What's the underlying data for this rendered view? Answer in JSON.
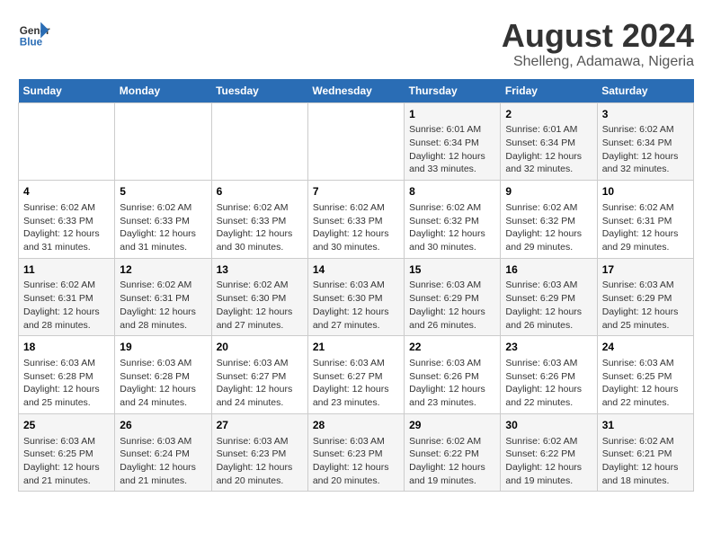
{
  "logo": {
    "line1": "General",
    "line2": "Blue"
  },
  "title": "August 2024",
  "subtitle": "Shelleng, Adamawa, Nigeria",
  "weekdays": [
    "Sunday",
    "Monday",
    "Tuesday",
    "Wednesday",
    "Thursday",
    "Friday",
    "Saturday"
  ],
  "weeks": [
    [
      {
        "day": "",
        "info": ""
      },
      {
        "day": "",
        "info": ""
      },
      {
        "day": "",
        "info": ""
      },
      {
        "day": "",
        "info": ""
      },
      {
        "day": "1",
        "info": "Sunrise: 6:01 AM\nSunset: 6:34 PM\nDaylight: 12 hours\nand 33 minutes."
      },
      {
        "day": "2",
        "info": "Sunrise: 6:01 AM\nSunset: 6:34 PM\nDaylight: 12 hours\nand 32 minutes."
      },
      {
        "day": "3",
        "info": "Sunrise: 6:02 AM\nSunset: 6:34 PM\nDaylight: 12 hours\nand 32 minutes."
      }
    ],
    [
      {
        "day": "4",
        "info": "Sunrise: 6:02 AM\nSunset: 6:33 PM\nDaylight: 12 hours\nand 31 minutes."
      },
      {
        "day": "5",
        "info": "Sunrise: 6:02 AM\nSunset: 6:33 PM\nDaylight: 12 hours\nand 31 minutes."
      },
      {
        "day": "6",
        "info": "Sunrise: 6:02 AM\nSunset: 6:33 PM\nDaylight: 12 hours\nand 30 minutes."
      },
      {
        "day": "7",
        "info": "Sunrise: 6:02 AM\nSunset: 6:33 PM\nDaylight: 12 hours\nand 30 minutes."
      },
      {
        "day": "8",
        "info": "Sunrise: 6:02 AM\nSunset: 6:32 PM\nDaylight: 12 hours\nand 30 minutes."
      },
      {
        "day": "9",
        "info": "Sunrise: 6:02 AM\nSunset: 6:32 PM\nDaylight: 12 hours\nand 29 minutes."
      },
      {
        "day": "10",
        "info": "Sunrise: 6:02 AM\nSunset: 6:31 PM\nDaylight: 12 hours\nand 29 minutes."
      }
    ],
    [
      {
        "day": "11",
        "info": "Sunrise: 6:02 AM\nSunset: 6:31 PM\nDaylight: 12 hours\nand 28 minutes."
      },
      {
        "day": "12",
        "info": "Sunrise: 6:02 AM\nSunset: 6:31 PM\nDaylight: 12 hours\nand 28 minutes."
      },
      {
        "day": "13",
        "info": "Sunrise: 6:02 AM\nSunset: 6:30 PM\nDaylight: 12 hours\nand 27 minutes."
      },
      {
        "day": "14",
        "info": "Sunrise: 6:03 AM\nSunset: 6:30 PM\nDaylight: 12 hours\nand 27 minutes."
      },
      {
        "day": "15",
        "info": "Sunrise: 6:03 AM\nSunset: 6:29 PM\nDaylight: 12 hours\nand 26 minutes."
      },
      {
        "day": "16",
        "info": "Sunrise: 6:03 AM\nSunset: 6:29 PM\nDaylight: 12 hours\nand 26 minutes."
      },
      {
        "day": "17",
        "info": "Sunrise: 6:03 AM\nSunset: 6:29 PM\nDaylight: 12 hours\nand 25 minutes."
      }
    ],
    [
      {
        "day": "18",
        "info": "Sunrise: 6:03 AM\nSunset: 6:28 PM\nDaylight: 12 hours\nand 25 minutes."
      },
      {
        "day": "19",
        "info": "Sunrise: 6:03 AM\nSunset: 6:28 PM\nDaylight: 12 hours\nand 24 minutes."
      },
      {
        "day": "20",
        "info": "Sunrise: 6:03 AM\nSunset: 6:27 PM\nDaylight: 12 hours\nand 24 minutes."
      },
      {
        "day": "21",
        "info": "Sunrise: 6:03 AM\nSunset: 6:27 PM\nDaylight: 12 hours\nand 23 minutes."
      },
      {
        "day": "22",
        "info": "Sunrise: 6:03 AM\nSunset: 6:26 PM\nDaylight: 12 hours\nand 23 minutes."
      },
      {
        "day": "23",
        "info": "Sunrise: 6:03 AM\nSunset: 6:26 PM\nDaylight: 12 hours\nand 22 minutes."
      },
      {
        "day": "24",
        "info": "Sunrise: 6:03 AM\nSunset: 6:25 PM\nDaylight: 12 hours\nand 22 minutes."
      }
    ],
    [
      {
        "day": "25",
        "info": "Sunrise: 6:03 AM\nSunset: 6:25 PM\nDaylight: 12 hours\nand 21 minutes."
      },
      {
        "day": "26",
        "info": "Sunrise: 6:03 AM\nSunset: 6:24 PM\nDaylight: 12 hours\nand 21 minutes."
      },
      {
        "day": "27",
        "info": "Sunrise: 6:03 AM\nSunset: 6:23 PM\nDaylight: 12 hours\nand 20 minutes."
      },
      {
        "day": "28",
        "info": "Sunrise: 6:03 AM\nSunset: 6:23 PM\nDaylight: 12 hours\nand 20 minutes."
      },
      {
        "day": "29",
        "info": "Sunrise: 6:02 AM\nSunset: 6:22 PM\nDaylight: 12 hours\nand 19 minutes."
      },
      {
        "day": "30",
        "info": "Sunrise: 6:02 AM\nSunset: 6:22 PM\nDaylight: 12 hours\nand 19 minutes."
      },
      {
        "day": "31",
        "info": "Sunrise: 6:02 AM\nSunset: 6:21 PM\nDaylight: 12 hours\nand 18 minutes."
      }
    ]
  ]
}
